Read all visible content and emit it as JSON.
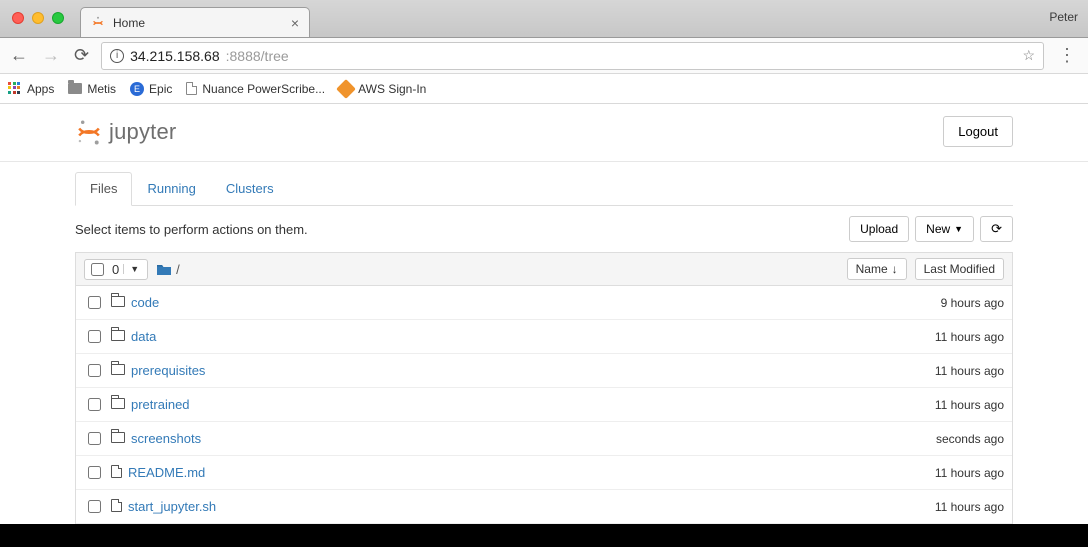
{
  "browser": {
    "tab_title": "Home",
    "user": "Peter",
    "url_host": "34.215.158.68",
    "url_rest": ":8888/tree",
    "bookmarks": {
      "apps": "Apps",
      "metis": "Metis",
      "epic": "Epic",
      "epic_letter": "E",
      "nuance": "Nuance PowerScribe...",
      "aws": "AWS Sign-In"
    }
  },
  "jupyter": {
    "brand": "jupyter",
    "logout": "Logout",
    "tabs": {
      "files": "Files",
      "running": "Running",
      "clusters": "Clusters"
    },
    "hint": "Select items to perform actions on them.",
    "upload": "Upload",
    "new": "New",
    "selected_count": "0",
    "breadcrumb_slash": "/",
    "sort_name": "Name",
    "sort_modified": "Last Modified",
    "items": [
      {
        "type": "folder",
        "name": "code",
        "time": "9 hours ago"
      },
      {
        "type": "folder",
        "name": "data",
        "time": "11 hours ago"
      },
      {
        "type": "folder",
        "name": "prerequisites",
        "time": "11 hours ago"
      },
      {
        "type": "folder",
        "name": "pretrained",
        "time": "11 hours ago"
      },
      {
        "type": "folder",
        "name": "screenshots",
        "time": "seconds ago"
      },
      {
        "type": "file",
        "name": "README.md",
        "time": "11 hours ago"
      },
      {
        "type": "file",
        "name": "start_jupyter.sh",
        "time": "11 hours ago"
      }
    ]
  }
}
